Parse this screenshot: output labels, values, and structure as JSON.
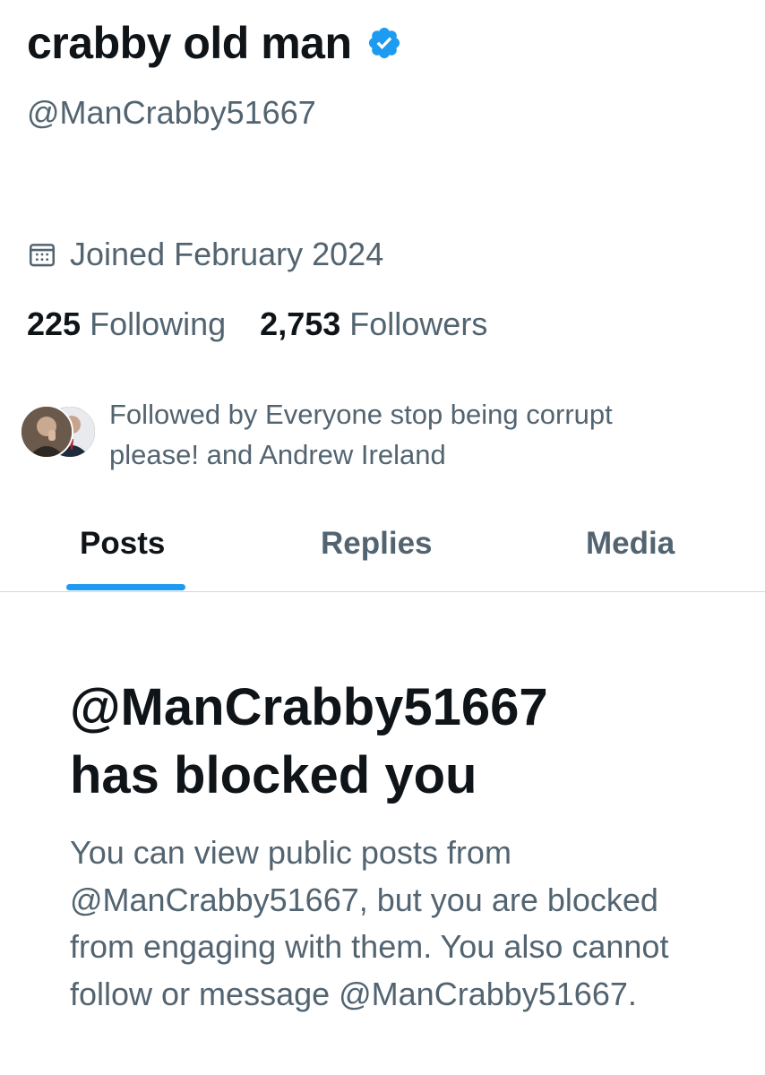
{
  "profile": {
    "display_name": "crabby old man",
    "handle": "@ManCrabby51667",
    "joined": "Joined February 2024",
    "following_count": "225",
    "following_label": "Following",
    "followers_count": "2,753",
    "followers_label": "Followers",
    "followed_by_text": "Followed by Everyone stop being corrupt please! and Andrew Ireland"
  },
  "tabs": [
    {
      "label": "Posts",
      "active": true
    },
    {
      "label": "Replies",
      "active": false
    },
    {
      "label": "Media",
      "active": false
    }
  ],
  "blocked": {
    "title_line1": "@ManCrabby51667",
    "title_line2": "has blocked you",
    "body": "You can view public posts from @ManCrabby51667, but you are blocked from engaging with them. You also cannot follow or message @ManCrabby51667."
  },
  "colors": {
    "accent": "#1d9bf0",
    "text_primary": "#0f1419",
    "text_secondary": "#536471",
    "divider": "#cfd9de"
  },
  "icons": {
    "verified": "verified-badge-icon",
    "calendar": "calendar-icon"
  }
}
